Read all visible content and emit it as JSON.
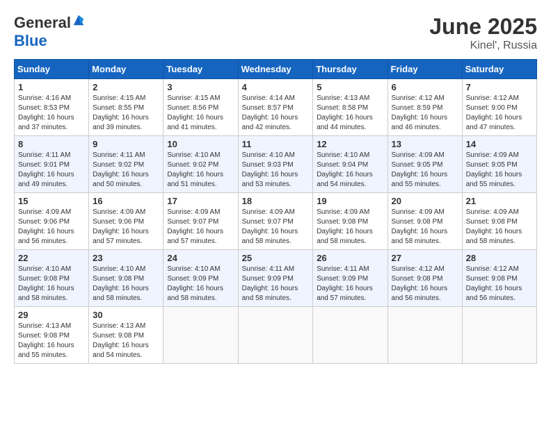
{
  "header": {
    "logo_general": "General",
    "logo_blue": "Blue",
    "month_year": "June 2025",
    "location": "Kinel', Russia"
  },
  "weekdays": [
    "Sunday",
    "Monday",
    "Tuesday",
    "Wednesday",
    "Thursday",
    "Friday",
    "Saturday"
  ],
  "weeks": [
    [
      {
        "day": "1",
        "sunrise": "4:16 AM",
        "sunset": "8:53 PM",
        "daylight": "16 hours and 37 minutes."
      },
      {
        "day": "2",
        "sunrise": "4:15 AM",
        "sunset": "8:55 PM",
        "daylight": "16 hours and 39 minutes."
      },
      {
        "day": "3",
        "sunrise": "4:15 AM",
        "sunset": "8:56 PM",
        "daylight": "16 hours and 41 minutes."
      },
      {
        "day": "4",
        "sunrise": "4:14 AM",
        "sunset": "8:57 PM",
        "daylight": "16 hours and 42 minutes."
      },
      {
        "day": "5",
        "sunrise": "4:13 AM",
        "sunset": "8:58 PM",
        "daylight": "16 hours and 44 minutes."
      },
      {
        "day": "6",
        "sunrise": "4:12 AM",
        "sunset": "8:59 PM",
        "daylight": "16 hours and 46 minutes."
      },
      {
        "day": "7",
        "sunrise": "4:12 AM",
        "sunset": "9:00 PM",
        "daylight": "16 hours and 47 minutes."
      }
    ],
    [
      {
        "day": "8",
        "sunrise": "4:11 AM",
        "sunset": "9:01 PM",
        "daylight": "16 hours and 49 minutes."
      },
      {
        "day": "9",
        "sunrise": "4:11 AM",
        "sunset": "9:02 PM",
        "daylight": "16 hours and 50 minutes."
      },
      {
        "day": "10",
        "sunrise": "4:10 AM",
        "sunset": "9:02 PM",
        "daylight": "16 hours and 51 minutes."
      },
      {
        "day": "11",
        "sunrise": "4:10 AM",
        "sunset": "9:03 PM",
        "daylight": "16 hours and 53 minutes."
      },
      {
        "day": "12",
        "sunrise": "4:10 AM",
        "sunset": "9:04 PM",
        "daylight": "16 hours and 54 minutes."
      },
      {
        "day": "13",
        "sunrise": "4:09 AM",
        "sunset": "9:05 PM",
        "daylight": "16 hours and 55 minutes."
      },
      {
        "day": "14",
        "sunrise": "4:09 AM",
        "sunset": "9:05 PM",
        "daylight": "16 hours and 55 minutes."
      }
    ],
    [
      {
        "day": "15",
        "sunrise": "4:09 AM",
        "sunset": "9:06 PM",
        "daylight": "16 hours and 56 minutes."
      },
      {
        "day": "16",
        "sunrise": "4:09 AM",
        "sunset": "9:06 PM",
        "daylight": "16 hours and 57 minutes."
      },
      {
        "day": "17",
        "sunrise": "4:09 AM",
        "sunset": "9:07 PM",
        "daylight": "16 hours and 57 minutes."
      },
      {
        "day": "18",
        "sunrise": "4:09 AM",
        "sunset": "9:07 PM",
        "daylight": "16 hours and 58 minutes."
      },
      {
        "day": "19",
        "sunrise": "4:09 AM",
        "sunset": "9:08 PM",
        "daylight": "16 hours and 58 minutes."
      },
      {
        "day": "20",
        "sunrise": "4:09 AM",
        "sunset": "9:08 PM",
        "daylight": "16 hours and 58 minutes."
      },
      {
        "day": "21",
        "sunrise": "4:09 AM",
        "sunset": "9:08 PM",
        "daylight": "16 hours and 58 minutes."
      }
    ],
    [
      {
        "day": "22",
        "sunrise": "4:10 AM",
        "sunset": "9:08 PM",
        "daylight": "16 hours and 58 minutes."
      },
      {
        "day": "23",
        "sunrise": "4:10 AM",
        "sunset": "9:08 PM",
        "daylight": "16 hours and 58 minutes."
      },
      {
        "day": "24",
        "sunrise": "4:10 AM",
        "sunset": "9:09 PM",
        "daylight": "16 hours and 58 minutes."
      },
      {
        "day": "25",
        "sunrise": "4:11 AM",
        "sunset": "9:09 PM",
        "daylight": "16 hours and 58 minutes."
      },
      {
        "day": "26",
        "sunrise": "4:11 AM",
        "sunset": "9:09 PM",
        "daylight": "16 hours and 57 minutes."
      },
      {
        "day": "27",
        "sunrise": "4:12 AM",
        "sunset": "9:08 PM",
        "daylight": "16 hours and 56 minutes."
      },
      {
        "day": "28",
        "sunrise": "4:12 AM",
        "sunset": "9:08 PM",
        "daylight": "16 hours and 56 minutes."
      }
    ],
    [
      {
        "day": "29",
        "sunrise": "4:13 AM",
        "sunset": "9:08 PM",
        "daylight": "16 hours and 55 minutes."
      },
      {
        "day": "30",
        "sunrise": "4:13 AM",
        "sunset": "9:08 PM",
        "daylight": "16 hours and 54 minutes."
      },
      null,
      null,
      null,
      null,
      null
    ]
  ]
}
